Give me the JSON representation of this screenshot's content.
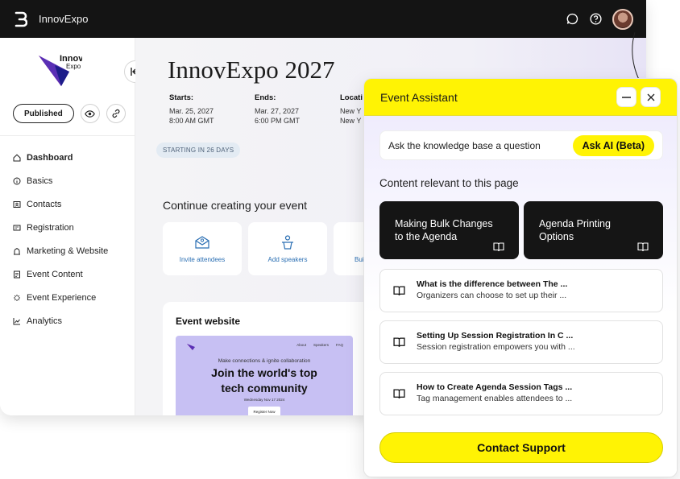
{
  "app": {
    "title": "InnovExpo"
  },
  "event": {
    "logo_line1": "Innov",
    "logo_line2": "Expo",
    "title": "InnovExpo 2027",
    "status": "Published",
    "starts_label": "Starts:",
    "starts_date": "Mar. 25, 2027",
    "starts_time": "8:00 AM GMT",
    "ends_label": "Ends:",
    "ends_date": "Mar. 27, 2027",
    "ends_time": "6:00 PM GMT",
    "location_label": "Locati",
    "location_line1": "New Y",
    "location_line2": "New Y",
    "starting_badge": "STARTING IN 26 DAYS"
  },
  "sidebar": {
    "items": [
      {
        "label": "Dashboard",
        "icon": "home-icon",
        "active": true
      },
      {
        "label": "Basics",
        "icon": "info-icon",
        "active": false
      },
      {
        "label": "Contacts",
        "icon": "contacts-icon",
        "active": false
      },
      {
        "label": "Registration",
        "icon": "registration-icon",
        "active": false
      },
      {
        "label": "Marketing & Website",
        "icon": "marketing-icon",
        "active": false
      },
      {
        "label": "Event Content",
        "icon": "content-icon",
        "active": false
      },
      {
        "label": "Event Experience",
        "icon": "experience-icon",
        "active": false
      },
      {
        "label": "Analytics",
        "icon": "analytics-icon",
        "active": false
      }
    ]
  },
  "main": {
    "continue_title": "Continue creating your event",
    "cards": [
      {
        "label": "Invite attendees",
        "icon": "envelope-icon"
      },
      {
        "label": "Add speakers",
        "icon": "speaker-icon"
      },
      {
        "label": "Bui",
        "icon": "build-icon"
      }
    ],
    "website": {
      "title": "Event website",
      "nav": [
        "About",
        "Speakers",
        "FAQ"
      ],
      "tagline": "Make connections & ignite collaboration",
      "headline1": "Join the world's top",
      "headline2": "tech community",
      "date": "Wednesday Nov 17 2024",
      "button": "Register Now"
    }
  },
  "assistant": {
    "title": "Event Assistant",
    "ask_placeholder": "Ask the knowledge base a question",
    "ask_button": "Ask AI (Beta)",
    "relevant_title": "Content relevant to this page",
    "featured": [
      {
        "line1": "Making Bulk Changes",
        "line2": "to the Agenda"
      },
      {
        "line1": "Agenda Printing",
        "line2": "Options"
      }
    ],
    "articles": [
      {
        "title": "What is the difference between The ...",
        "snippet": "Organizers can choose to set up their ..."
      },
      {
        "title": "Setting Up Session Registration In C ...",
        "snippet": "Session registration empowers you with ..."
      },
      {
        "title": "How to Create Agenda Session Tags ...",
        "snippet": "Tag management enables attendees to ..."
      }
    ],
    "contact_button": "Contact Support"
  },
  "colors": {
    "accent_yellow": "#fff304",
    "topbar": "#141414",
    "link_blue": "#2b6fb3"
  }
}
